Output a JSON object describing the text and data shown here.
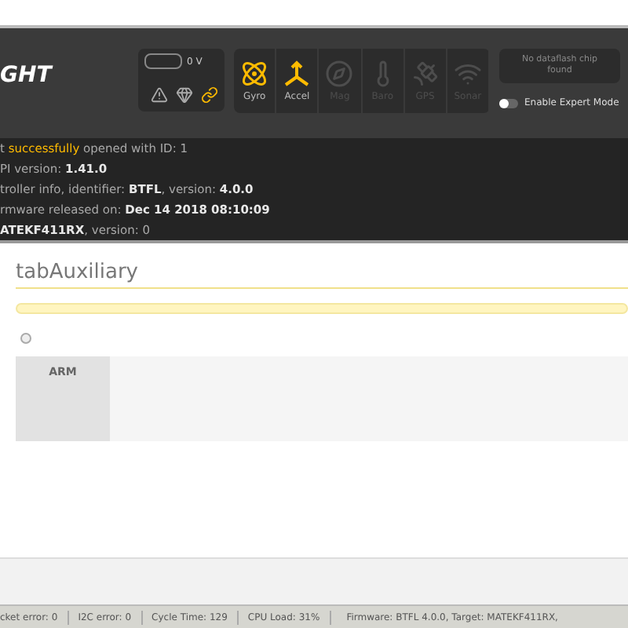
{
  "header": {
    "logo": "GHT",
    "battery": {
      "reading": "0 V"
    },
    "status_icons": [
      {
        "kind": "warning",
        "active": false
      },
      {
        "kind": "gem",
        "active": false
      },
      {
        "kind": "link",
        "active": true
      }
    ],
    "sensors": [
      {
        "kind": "gyro",
        "label": "Gyro",
        "active": true
      },
      {
        "kind": "accel",
        "label": "Accel",
        "active": true
      },
      {
        "kind": "mag",
        "label": "Mag",
        "active": false
      },
      {
        "kind": "baro",
        "label": "Baro",
        "active": false
      },
      {
        "kind": "gps",
        "label": "GPS",
        "active": false
      },
      {
        "kind": "sonar",
        "label": "Sonar",
        "active": false
      }
    ],
    "dataflash": "No dataflash chip found",
    "expert_mode": {
      "label": "Enable Expert Mode",
      "on": false
    }
  },
  "log": [
    [
      {
        "text": "t "
      },
      {
        "text": "successfully",
        "kind": "highlight"
      },
      {
        "text": " opened with ID: 1"
      }
    ],
    [
      {
        "text": "PI version: "
      },
      {
        "text": "1.41.0",
        "kind": "bold"
      }
    ],
    [
      {
        "text": "troller info, identifier: "
      },
      {
        "text": "BTFL",
        "kind": "bold"
      },
      {
        "text": ", version: "
      },
      {
        "text": "4.0.0",
        "kind": "bold"
      }
    ],
    [
      {
        "text": "rmware released on: "
      },
      {
        "text": "Dec 14 2018 08:10:09",
        "kind": "bold"
      }
    ],
    [
      {
        "text": "ATEKF411RX",
        "kind": "bold"
      },
      {
        "text": ", version: 0"
      }
    ]
  ],
  "content": {
    "title": "tabAuxiliary",
    "checkbox": {
      "checked": false
    },
    "modes": [
      {
        "name": "ARM"
      }
    ]
  },
  "status_bar": [
    "cket error: 0",
    "I2C error: 0",
    "Cycle Time: 129",
    "CPU Load: 31%",
    "Firmware: BTFL 4.0.0, Target: MATEKF411RX,"
  ]
}
